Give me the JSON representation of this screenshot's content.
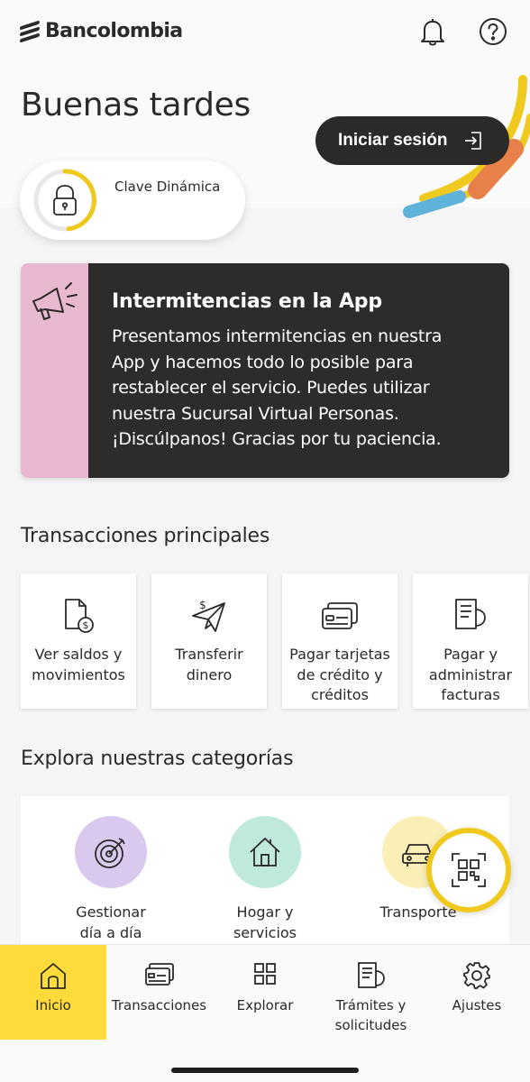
{
  "header": {
    "brand": "Bancolombia",
    "notification_icon": "bell-icon",
    "help_icon": "question-circle-icon"
  },
  "greeting": "Buenas tardes",
  "login": {
    "label": "Iniciar sesión",
    "icon": "sign-in-icon"
  },
  "clave": {
    "title": "Clave Dinámica",
    "icon": "lock-icon"
  },
  "alert": {
    "title": "Intermitencias en la App",
    "lines": [
      "Presentamos  intermitencias en nuestra",
      "App y hacemos todo lo posible para",
      "restablecer el servicio. Puedes utilizar",
      "nuestra Sucursal Virtual Personas.",
      "¡Discúlpanos! Gracias por tu paciencia."
    ],
    "icon": "megaphone-icon"
  },
  "transactions": {
    "title": "Transacciones principales",
    "items": [
      {
        "lines": [
          "Ver saldos y",
          "movimientos"
        ],
        "icon": "document-money-icon"
      },
      {
        "lines": [
          "Transferir",
          "dinero"
        ],
        "icon": "paper-plane-money-icon"
      },
      {
        "lines": [
          "Pagar tarjetas",
          "de crédito y",
          "créditos"
        ],
        "icon": "credit-card-icon"
      },
      {
        "lines": [
          "Pagar y",
          "administrar",
          "facturas"
        ],
        "icon": "invoice-icon"
      }
    ]
  },
  "categories": {
    "title": "Explora nuestras categorías",
    "items": [
      {
        "lines": [
          "Gestionar",
          "día a día"
        ],
        "icon": "target-icon",
        "color": "#d9c9ee"
      },
      {
        "lines": [
          "Hogar y",
          "servicios"
        ],
        "icon": "house-icon",
        "color": "#bfe9dc"
      },
      {
        "lines": [
          "Transporte"
        ],
        "icon": "car-icon",
        "color": "#fbefb8"
      }
    ]
  },
  "qr": {
    "icon": "qr-code-icon"
  },
  "nav": {
    "items": [
      {
        "lines": [
          "Inicio"
        ],
        "icon": "home-icon",
        "active": true
      },
      {
        "lines": [
          "Transacciones"
        ],
        "icon": "card-transactions-icon"
      },
      {
        "lines": [
          "Explorar"
        ],
        "icon": "grid-icon"
      },
      {
        "lines": [
          "Trámites y",
          "solicitudes"
        ],
        "icon": "document-icon"
      },
      {
        "lines": [
          "Ajustes"
        ],
        "icon": "gear-icon"
      }
    ]
  },
  "colors": {
    "brand_dark": "#2c2a29",
    "accent_yellow": "#fddb3a",
    "alert_pink": "#e8b8d0",
    "deco_orange": "#e8804a",
    "deco_blue": "#5fb2d9"
  }
}
